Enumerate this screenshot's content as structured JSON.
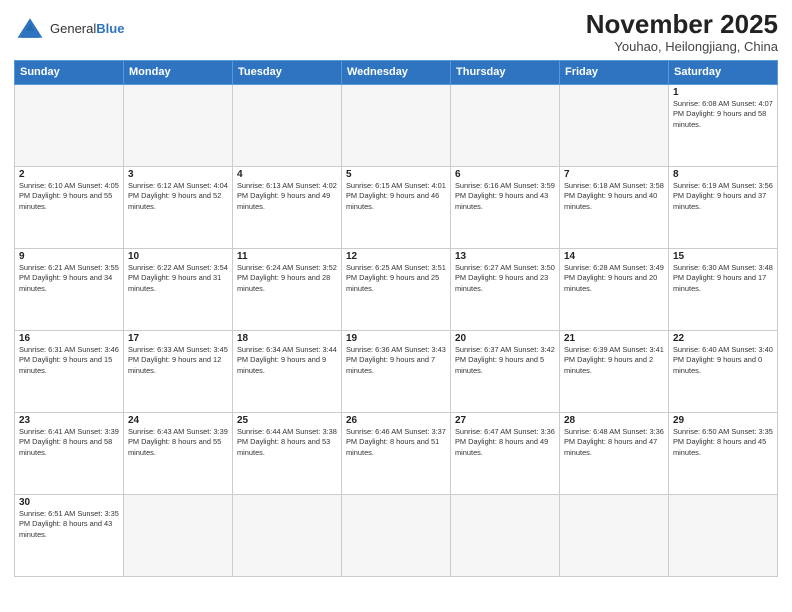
{
  "logo": {
    "text_general": "General",
    "text_blue": "Blue"
  },
  "title": {
    "month_year": "November 2025",
    "location": "Youhao, Heilongjiang, China"
  },
  "weekdays": [
    "Sunday",
    "Monday",
    "Tuesday",
    "Wednesday",
    "Thursday",
    "Friday",
    "Saturday"
  ],
  "weeks": [
    [
      {
        "day": "",
        "info": ""
      },
      {
        "day": "",
        "info": ""
      },
      {
        "day": "",
        "info": ""
      },
      {
        "day": "",
        "info": ""
      },
      {
        "day": "",
        "info": ""
      },
      {
        "day": "",
        "info": ""
      },
      {
        "day": "1",
        "info": "Sunrise: 6:08 AM\nSunset: 4:07 PM\nDaylight: 9 hours\nand 58 minutes."
      }
    ],
    [
      {
        "day": "2",
        "info": "Sunrise: 6:10 AM\nSunset: 4:05 PM\nDaylight: 9 hours\nand 55 minutes."
      },
      {
        "day": "3",
        "info": "Sunrise: 6:12 AM\nSunset: 4:04 PM\nDaylight: 9 hours\nand 52 minutes."
      },
      {
        "day": "4",
        "info": "Sunrise: 6:13 AM\nSunset: 4:02 PM\nDaylight: 9 hours\nand 49 minutes."
      },
      {
        "day": "5",
        "info": "Sunrise: 6:15 AM\nSunset: 4:01 PM\nDaylight: 9 hours\nand 46 minutes."
      },
      {
        "day": "6",
        "info": "Sunrise: 6:16 AM\nSunset: 3:59 PM\nDaylight: 9 hours\nand 43 minutes."
      },
      {
        "day": "7",
        "info": "Sunrise: 6:18 AM\nSunset: 3:58 PM\nDaylight: 9 hours\nand 40 minutes."
      },
      {
        "day": "8",
        "info": "Sunrise: 6:19 AM\nSunset: 3:56 PM\nDaylight: 9 hours\nand 37 minutes."
      }
    ],
    [
      {
        "day": "9",
        "info": "Sunrise: 6:21 AM\nSunset: 3:55 PM\nDaylight: 9 hours\nand 34 minutes."
      },
      {
        "day": "10",
        "info": "Sunrise: 6:22 AM\nSunset: 3:54 PM\nDaylight: 9 hours\nand 31 minutes."
      },
      {
        "day": "11",
        "info": "Sunrise: 6:24 AM\nSunset: 3:52 PM\nDaylight: 9 hours\nand 28 minutes."
      },
      {
        "day": "12",
        "info": "Sunrise: 6:25 AM\nSunset: 3:51 PM\nDaylight: 9 hours\nand 25 minutes."
      },
      {
        "day": "13",
        "info": "Sunrise: 6:27 AM\nSunset: 3:50 PM\nDaylight: 9 hours\nand 23 minutes."
      },
      {
        "day": "14",
        "info": "Sunrise: 6:28 AM\nSunset: 3:49 PM\nDaylight: 9 hours\nand 20 minutes."
      },
      {
        "day": "15",
        "info": "Sunrise: 6:30 AM\nSunset: 3:48 PM\nDaylight: 9 hours\nand 17 minutes."
      }
    ],
    [
      {
        "day": "16",
        "info": "Sunrise: 6:31 AM\nSunset: 3:46 PM\nDaylight: 9 hours\nand 15 minutes."
      },
      {
        "day": "17",
        "info": "Sunrise: 6:33 AM\nSunset: 3:45 PM\nDaylight: 9 hours\nand 12 minutes."
      },
      {
        "day": "18",
        "info": "Sunrise: 6:34 AM\nSunset: 3:44 PM\nDaylight: 9 hours\nand 9 minutes."
      },
      {
        "day": "19",
        "info": "Sunrise: 6:36 AM\nSunset: 3:43 PM\nDaylight: 9 hours\nand 7 minutes."
      },
      {
        "day": "20",
        "info": "Sunrise: 6:37 AM\nSunset: 3:42 PM\nDaylight: 9 hours\nand 5 minutes."
      },
      {
        "day": "21",
        "info": "Sunrise: 6:39 AM\nSunset: 3:41 PM\nDaylight: 9 hours\nand 2 minutes."
      },
      {
        "day": "22",
        "info": "Sunrise: 6:40 AM\nSunset: 3:40 PM\nDaylight: 9 hours\nand 0 minutes."
      }
    ],
    [
      {
        "day": "23",
        "info": "Sunrise: 6:41 AM\nSunset: 3:39 PM\nDaylight: 8 hours\nand 58 minutes."
      },
      {
        "day": "24",
        "info": "Sunrise: 6:43 AM\nSunset: 3:39 PM\nDaylight: 8 hours\nand 55 minutes."
      },
      {
        "day": "25",
        "info": "Sunrise: 6:44 AM\nSunset: 3:38 PM\nDaylight: 8 hours\nand 53 minutes."
      },
      {
        "day": "26",
        "info": "Sunrise: 6:46 AM\nSunset: 3:37 PM\nDaylight: 8 hours\nand 51 minutes."
      },
      {
        "day": "27",
        "info": "Sunrise: 6:47 AM\nSunset: 3:36 PM\nDaylight: 8 hours\nand 49 minutes."
      },
      {
        "day": "28",
        "info": "Sunrise: 6:48 AM\nSunset: 3:36 PM\nDaylight: 8 hours\nand 47 minutes."
      },
      {
        "day": "29",
        "info": "Sunrise: 6:50 AM\nSunset: 3:35 PM\nDaylight: 8 hours\nand 45 minutes."
      }
    ],
    [
      {
        "day": "30",
        "info": "Sunrise: 6:51 AM\nSunset: 3:35 PM\nDaylight: 8 hours\nand 43 minutes."
      },
      {
        "day": "",
        "info": ""
      },
      {
        "day": "",
        "info": ""
      },
      {
        "day": "",
        "info": ""
      },
      {
        "day": "",
        "info": ""
      },
      {
        "day": "",
        "info": ""
      },
      {
        "day": "",
        "info": ""
      }
    ]
  ]
}
